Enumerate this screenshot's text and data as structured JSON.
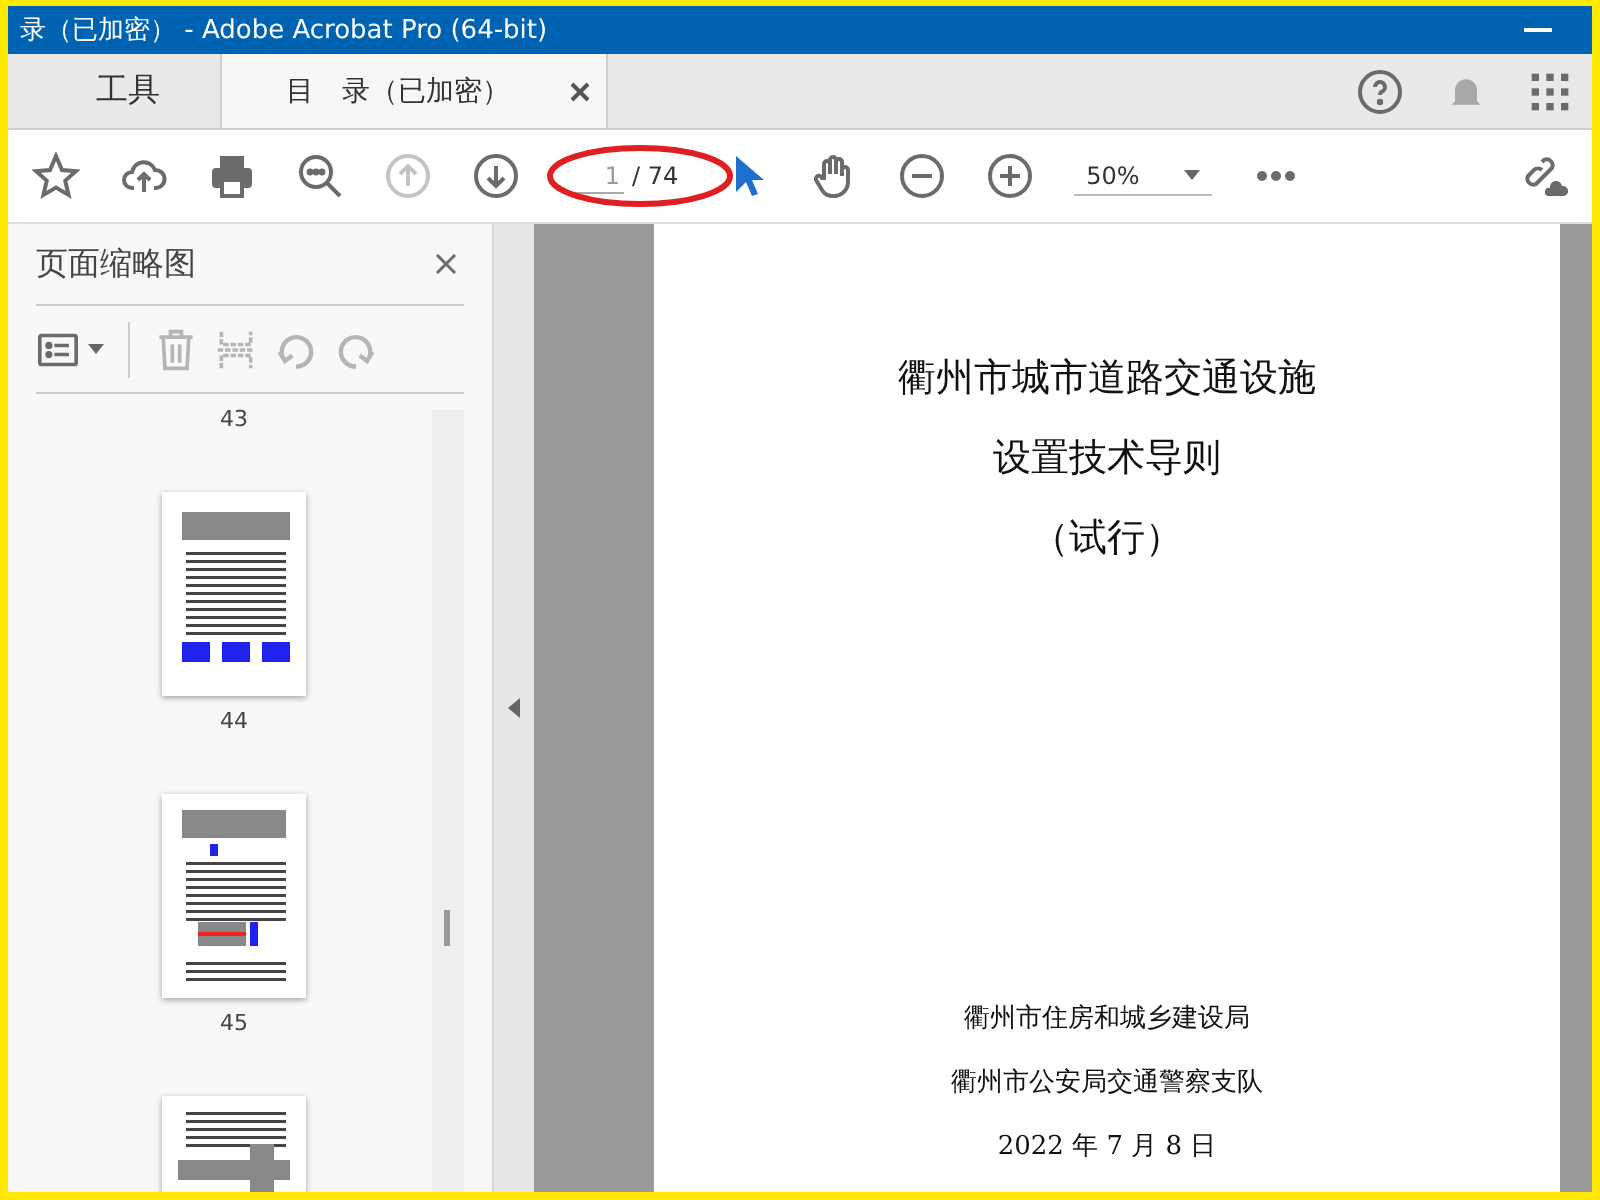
{
  "window": {
    "title": "录（已加密） - Adobe Acrobat Pro (64-bit)"
  },
  "tabs": [
    {
      "label": "工具",
      "selected": false
    },
    {
      "label": "目　录（已加密）",
      "selected": true
    }
  ],
  "toolbar": {
    "nav": [
      {
        "kind": "prev",
        "disabled": true
      },
      {
        "kind": "next",
        "disabled": false
      }
    ],
    "page_field": {
      "value": "1"
    },
    "page_total": "/ 74",
    "zoom": {
      "value": "50%"
    }
  },
  "thumbnails_panel": {
    "title": "页面缩略图",
    "top_label": "43",
    "pages": [
      {
        "kind": "signs",
        "label": "44"
      },
      {
        "kind": "road",
        "label": "45"
      },
      {
        "kind": "intersection"
      }
    ]
  },
  "document": {
    "title_lines": [
      "衢州市城市道路交通设施",
      "设置技术导则",
      "（试行）"
    ],
    "issuers": [
      "衢州市住房和城乡建设局",
      "衢州市公安局交通警察支队"
    ],
    "date": "2022 年 7 月 8 日"
  }
}
